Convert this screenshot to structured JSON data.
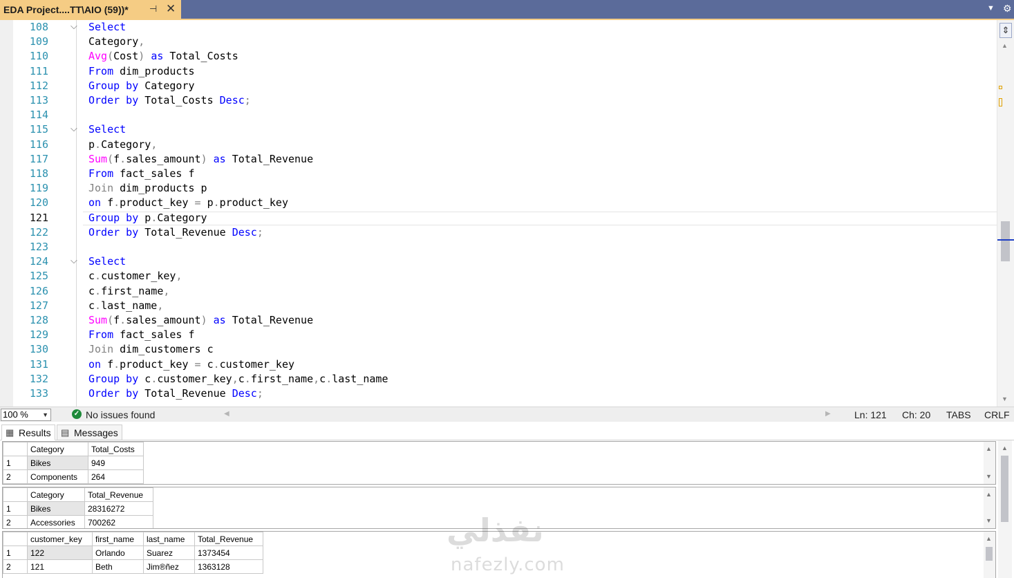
{
  "tab": {
    "title": "EDA Project....TT\\AIO (59))*",
    "pin_glyph": "⊣",
    "close_glyph": "✕"
  },
  "editor": {
    "current_line": 121,
    "lines": [
      {
        "n": "108",
        "fold": true,
        "tokens": [
          [
            "keyword",
            "Select"
          ]
        ]
      },
      {
        "n": "109",
        "fold": false,
        "tokens": [
          [
            "ident",
            "Category"
          ],
          [
            "op",
            ","
          ]
        ]
      },
      {
        "n": "110",
        "fold": false,
        "tokens": [
          [
            "func",
            "Avg"
          ],
          [
            "op",
            "("
          ],
          [
            "ident",
            "Cost"
          ],
          [
            "op",
            ")"
          ],
          [
            "ident",
            " "
          ],
          [
            "keyword",
            "as"
          ],
          [
            "ident",
            " Total_Costs"
          ]
        ]
      },
      {
        "n": "111",
        "fold": false,
        "tokens": [
          [
            "keyword",
            "From"
          ],
          [
            "ident",
            " dim_products"
          ]
        ]
      },
      {
        "n": "112",
        "fold": false,
        "tokens": [
          [
            "keyword",
            "Group by"
          ],
          [
            "ident",
            " Category"
          ]
        ]
      },
      {
        "n": "113",
        "fold": false,
        "tokens": [
          [
            "keyword",
            "Order by"
          ],
          [
            "ident",
            " Total_Costs "
          ],
          [
            "keyword",
            "Desc"
          ],
          [
            "op",
            ";"
          ]
        ]
      },
      {
        "n": "114",
        "fold": false,
        "tokens": []
      },
      {
        "n": "115",
        "fold": true,
        "tokens": [
          [
            "keyword",
            "Select"
          ]
        ]
      },
      {
        "n": "116",
        "fold": false,
        "tokens": [
          [
            "ident",
            "p"
          ],
          [
            "op",
            "."
          ],
          [
            "ident",
            "Category"
          ],
          [
            "op",
            ","
          ]
        ]
      },
      {
        "n": "117",
        "fold": false,
        "tokens": [
          [
            "func",
            "Sum"
          ],
          [
            "op",
            "("
          ],
          [
            "ident",
            "f"
          ],
          [
            "op",
            "."
          ],
          [
            "ident",
            "sales_amount"
          ],
          [
            "op",
            ")"
          ],
          [
            "ident",
            " "
          ],
          [
            "keyword",
            "as"
          ],
          [
            "ident",
            " Total_Revenue"
          ]
        ]
      },
      {
        "n": "118",
        "fold": false,
        "tokens": [
          [
            "keyword",
            "From"
          ],
          [
            "ident",
            " fact_sales f"
          ]
        ]
      },
      {
        "n": "119",
        "fold": false,
        "tokens": [
          [
            "join",
            "Join"
          ],
          [
            "ident",
            " dim_products p"
          ]
        ]
      },
      {
        "n": "120",
        "fold": false,
        "tokens": [
          [
            "keyword",
            "on"
          ],
          [
            "ident",
            " f"
          ],
          [
            "op",
            "."
          ],
          [
            "ident",
            "product_key "
          ],
          [
            "op",
            "="
          ],
          [
            "ident",
            " p"
          ],
          [
            "op",
            "."
          ],
          [
            "ident",
            "product_key"
          ]
        ]
      },
      {
        "n": "121",
        "fold": false,
        "tokens": [
          [
            "keyword",
            "Group by"
          ],
          [
            "ident",
            " p"
          ],
          [
            "op",
            "."
          ],
          [
            "ident",
            "Category"
          ]
        ]
      },
      {
        "n": "122",
        "fold": false,
        "tokens": [
          [
            "keyword",
            "Order by"
          ],
          [
            "ident",
            " Total_Revenue "
          ],
          [
            "keyword",
            "Desc"
          ],
          [
            "op",
            ";"
          ]
        ]
      },
      {
        "n": "123",
        "fold": false,
        "tokens": []
      },
      {
        "n": "124",
        "fold": true,
        "tokens": [
          [
            "keyword",
            "Select"
          ]
        ]
      },
      {
        "n": "125",
        "fold": false,
        "tokens": [
          [
            "ident",
            "c"
          ],
          [
            "op",
            "."
          ],
          [
            "ident",
            "customer_key"
          ],
          [
            "op",
            ","
          ]
        ]
      },
      {
        "n": "126",
        "fold": false,
        "tokens": [
          [
            "ident",
            "c"
          ],
          [
            "op",
            "."
          ],
          [
            "ident",
            "first_name"
          ],
          [
            "op",
            ","
          ]
        ]
      },
      {
        "n": "127",
        "fold": false,
        "tokens": [
          [
            "ident",
            "c"
          ],
          [
            "op",
            "."
          ],
          [
            "ident",
            "last_name"
          ],
          [
            "op",
            ","
          ]
        ]
      },
      {
        "n": "128",
        "fold": false,
        "tokens": [
          [
            "func",
            "Sum"
          ],
          [
            "op",
            "("
          ],
          [
            "ident",
            "f"
          ],
          [
            "op",
            "."
          ],
          [
            "ident",
            "sales_amount"
          ],
          [
            "op",
            ")"
          ],
          [
            "ident",
            " "
          ],
          [
            "keyword",
            "as"
          ],
          [
            "ident",
            " Total_Revenue"
          ]
        ]
      },
      {
        "n": "129",
        "fold": false,
        "tokens": [
          [
            "keyword",
            "From"
          ],
          [
            "ident",
            " fact_sales f"
          ]
        ]
      },
      {
        "n": "130",
        "fold": false,
        "tokens": [
          [
            "join",
            "Join"
          ],
          [
            "ident",
            " dim_customers c"
          ]
        ]
      },
      {
        "n": "131",
        "fold": false,
        "tokens": [
          [
            "keyword",
            "on"
          ],
          [
            "ident",
            " f"
          ],
          [
            "op",
            "."
          ],
          [
            "ident",
            "product_key "
          ],
          [
            "op",
            "="
          ],
          [
            "ident",
            " c"
          ],
          [
            "op",
            "."
          ],
          [
            "ident",
            "customer_key"
          ]
        ]
      },
      {
        "n": "132",
        "fold": false,
        "tokens": [
          [
            "keyword",
            "Group by"
          ],
          [
            "ident",
            " c"
          ],
          [
            "op",
            "."
          ],
          [
            "ident",
            "customer_key"
          ],
          [
            "op",
            ","
          ],
          [
            "ident",
            "c"
          ],
          [
            "op",
            "."
          ],
          [
            "ident",
            "first_name"
          ],
          [
            "op",
            ","
          ],
          [
            "ident",
            "c"
          ],
          [
            "op",
            "."
          ],
          [
            "ident",
            "last_name"
          ]
        ]
      },
      {
        "n": "133",
        "fold": false,
        "tokens": [
          [
            "keyword",
            "Order by"
          ],
          [
            "ident",
            " Total_Revenue "
          ],
          [
            "keyword",
            "Desc"
          ],
          [
            "op",
            ";"
          ]
        ]
      }
    ]
  },
  "statusbar": {
    "zoom": "100 %",
    "issues": "No issues found",
    "ln": "Ln: 121",
    "ch": "Ch: 20",
    "indent": "TABS",
    "eol": "CRLF"
  },
  "results_tabs": {
    "results": "Results",
    "messages": "Messages"
  },
  "grids": [
    {
      "headers": [
        "Category",
        "Total_Costs"
      ],
      "rows": [
        [
          "1",
          "Bikes",
          "949"
        ],
        [
          "2",
          "Components",
          "264"
        ]
      ]
    },
    {
      "headers": [
        "Category",
        "Total_Revenue"
      ],
      "rows": [
        [
          "1",
          "Bikes",
          "28316272"
        ],
        [
          "2",
          "Accessories",
          "700262"
        ]
      ]
    },
    {
      "headers": [
        "customer_key",
        "first_name",
        "last_name",
        "Total_Revenue"
      ],
      "rows": [
        [
          "1",
          "122",
          "Orlando",
          "Suarez",
          "1373454"
        ],
        [
          "2",
          "121",
          "Beth",
          "Jim®ñez",
          "1363128"
        ]
      ]
    }
  ],
  "watermark": {
    "arabic": "نفذلي",
    "latin": "nafezly.com"
  },
  "colors": {
    "tab_active": "#f5cc84",
    "tabbar": "#5b6b9a",
    "keyword": "#0000ff",
    "function": "#ff00ff",
    "line_number": "#2b91af",
    "ok_icon": "#1e8a3a"
  }
}
